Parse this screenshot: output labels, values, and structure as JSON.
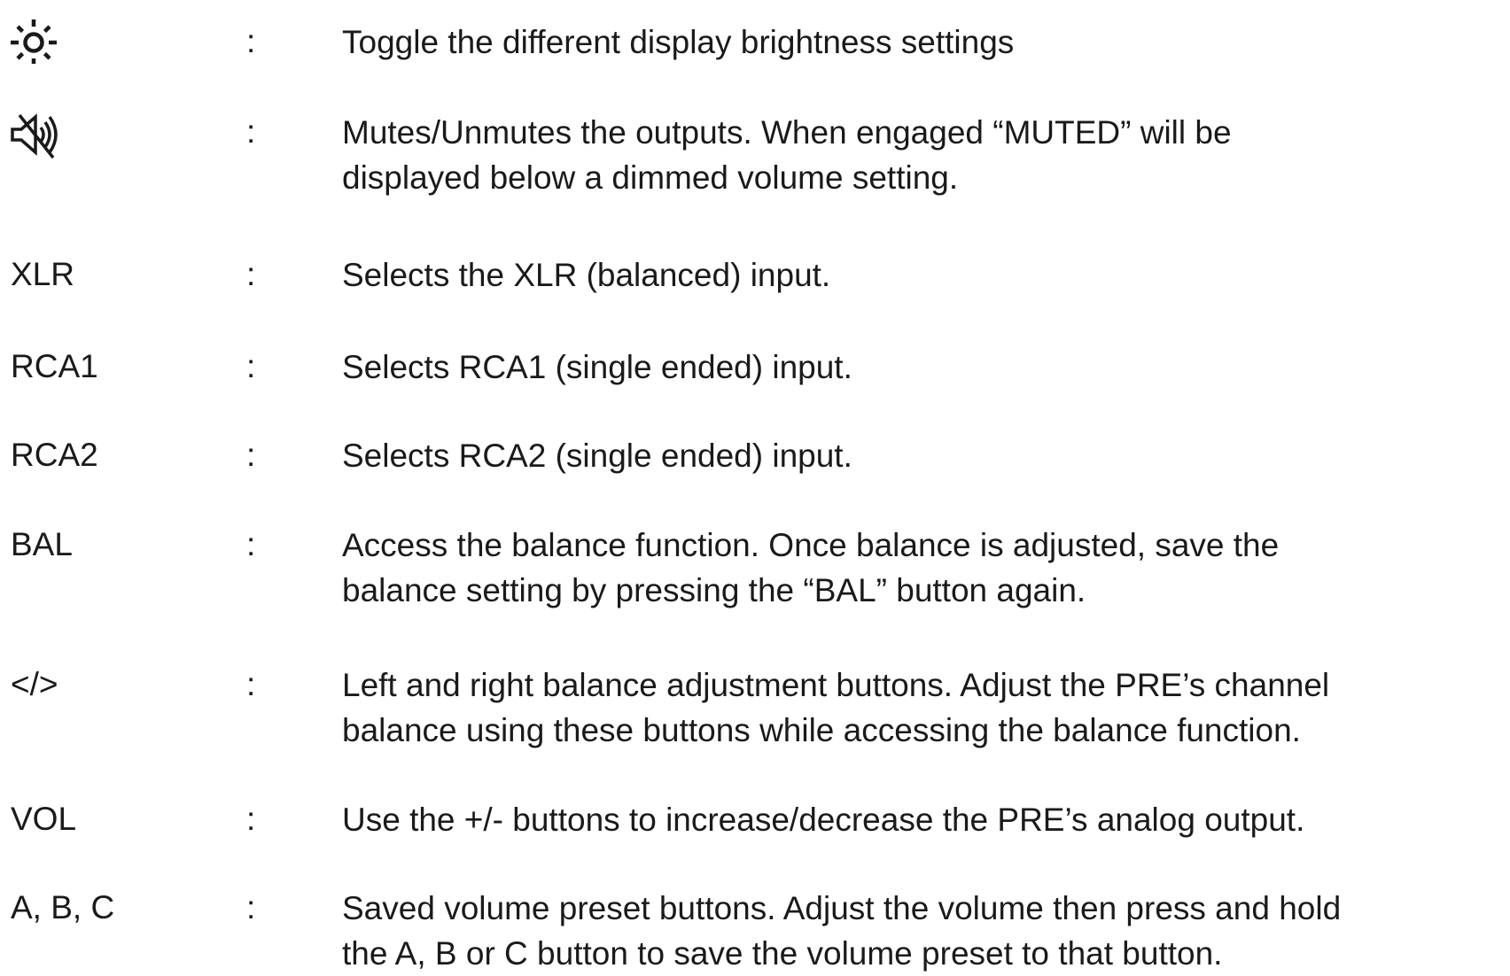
{
  "rows": [
    {
      "icon": "brightness-sun-icon",
      "key": "",
      "colon": ":",
      "lines": [
        "Toggle the different display brightness settings"
      ]
    },
    {
      "icon": "speaker-mute-icon",
      "key": "",
      "colon": ":",
      "lines": [
        "Mutes/Unmutes the outputs. When engaged “MUTED” will be",
        "displayed below a dimmed volume setting."
      ]
    },
    {
      "key": "XLR",
      "colon": ":",
      "lines": [
        "Selects the XLR (balanced) input."
      ]
    },
    {
      "key": "RCA1",
      "colon": ":",
      "lines": [
        "Selects RCA1 (single ended) input."
      ]
    },
    {
      "key": "RCA2",
      "colon": ":",
      "lines": [
        "Selects RCA2 (single ended) input."
      ]
    },
    {
      "key": "BAL",
      "colon": ":",
      "lines": [
        "Access the balance function. Once balance is adjusted, save the",
        "balance setting by pressing the “BAL” button again."
      ]
    },
    {
      "key": "</>",
      "colon": ":",
      "lines": [
        "Left and right balance adjustment buttons. Adjust the PRE’s channel",
        "balance using these buttons while accessing the balance function."
      ]
    },
    {
      "key": "VOL",
      "colon": ":",
      "lines": [
        "Use the +/- buttons to increase/decrease the PRE’s analog output."
      ]
    },
    {
      "key": "A, B, C",
      "colon": ":",
      "lines": [
        "Saved volume preset buttons. Adjust the volume then press and hold",
        "the A, B or C button to save the volume preset to that button."
      ]
    }
  ]
}
